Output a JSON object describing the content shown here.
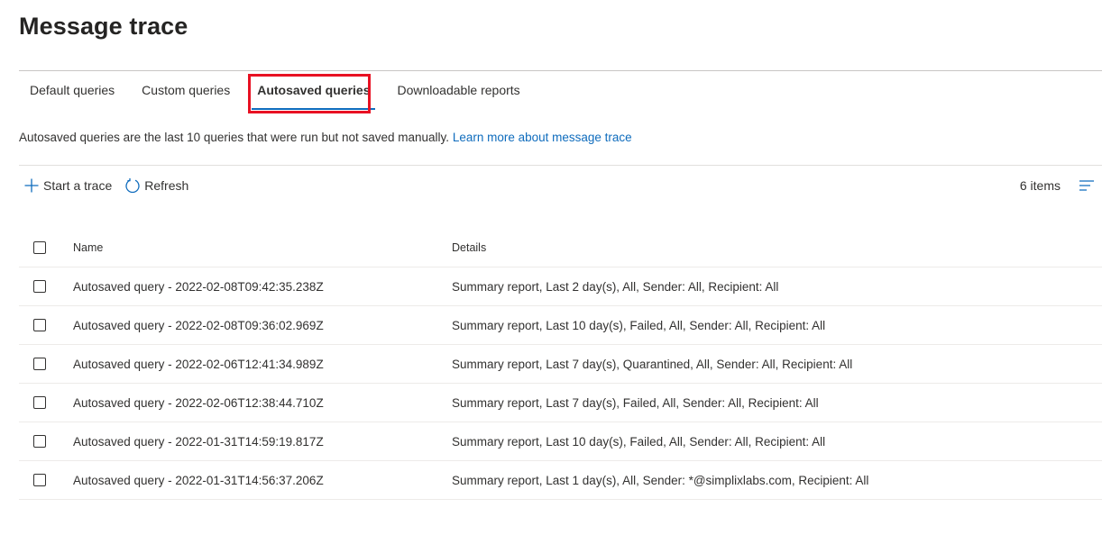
{
  "page": {
    "title": "Message trace"
  },
  "tabs": [
    {
      "label": "Default queries"
    },
    {
      "label": "Custom queries"
    },
    {
      "label": "Autosaved queries",
      "active": true
    },
    {
      "label": "Downloadable reports"
    }
  ],
  "description": {
    "text": "Autosaved queries are the last 10 queries that were run but not saved manually.",
    "link": "Learn more about message trace"
  },
  "toolbar": {
    "start_trace": "Start a trace",
    "refresh": "Refresh",
    "items_count": "6 items"
  },
  "table": {
    "columns": {
      "name": "Name",
      "details": "Details"
    },
    "rows": [
      {
        "name": "Autosaved query - 2022-02-08T09:42:35.238Z",
        "details": "Summary report, Last 2 day(s), All, Sender: All, Recipient: All"
      },
      {
        "name": "Autosaved query - 2022-02-08T09:36:02.969Z",
        "details": "Summary report, Last 10 day(s), Failed, All, Sender: All, Recipient: All"
      },
      {
        "name": "Autosaved query - 2022-02-06T12:41:34.989Z",
        "details": "Summary report, Last 7 day(s), Quarantined, All, Sender: All, Recipient: All"
      },
      {
        "name": "Autosaved query - 2022-02-06T12:38:44.710Z",
        "details": "Summary report, Last 7 day(s), Failed, All, Sender: All, Recipient: All"
      },
      {
        "name": "Autosaved query - 2022-01-31T14:59:19.817Z",
        "details": "Summary report, Last 10 day(s), Failed, All, Sender: All, Recipient: All"
      },
      {
        "name": "Autosaved query - 2022-01-31T14:56:37.206Z",
        "details": "Summary report, Last 1 day(s), All, Sender: *@simplixlabs.com, Recipient: All"
      }
    ]
  },
  "colors": {
    "accent": "#0f6cbd",
    "highlight_box": "#e81123",
    "text": "#323130"
  },
  "icons": [
    "plus-icon",
    "refresh-icon",
    "filter-lines-icon"
  ]
}
